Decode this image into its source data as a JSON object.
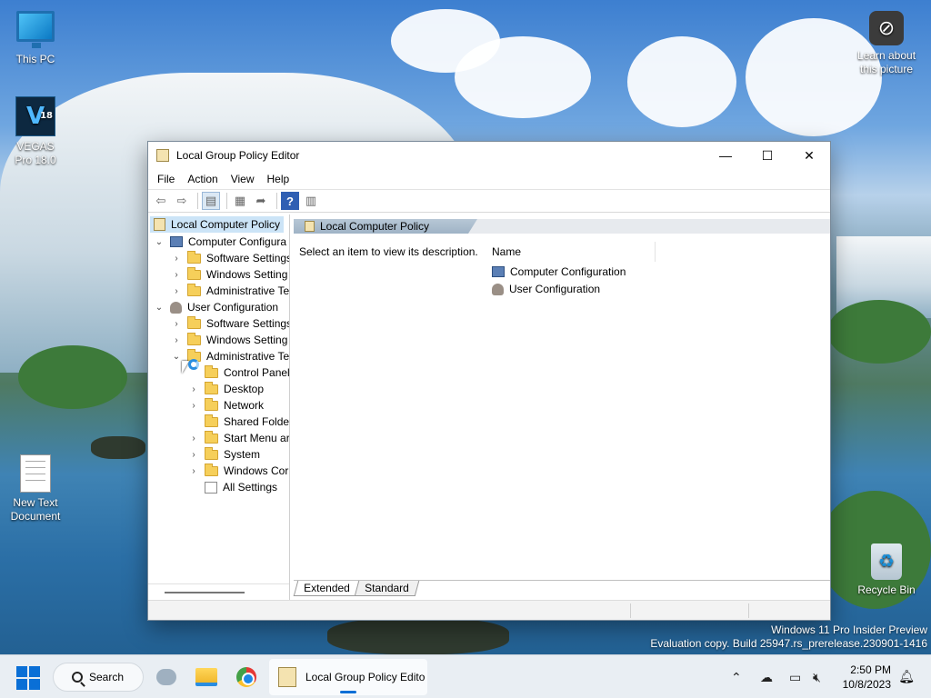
{
  "desktop": {
    "icons": [
      {
        "label": "This PC"
      },
      {
        "label": "VEGAS Pro 18.0",
        "glyph": "V",
        "badge": "18"
      },
      {
        "label": "New Text Document"
      },
      {
        "label": "Recycle Bin"
      },
      {
        "label": "Learn about this picture"
      }
    ],
    "watermark": {
      "line1": "Windows 11 Pro Insider Preview",
      "line2": "Evaluation copy. Build 25947.rs_prerelease.230901-1416"
    }
  },
  "window": {
    "title": "Local Group Policy Editor",
    "controls": {
      "minimize": "—",
      "maximize": "☐",
      "close": "✕"
    },
    "menu": [
      "File",
      "Action",
      "View",
      "Help"
    ],
    "toolbar_icons": [
      "back-arrow-icon",
      "forward-arrow-icon",
      "show-hide-tree-icon",
      "properties-icon",
      "export-list-icon",
      "help-icon",
      "filter-icon"
    ],
    "tree": {
      "root": "Local Computer Policy",
      "items": [
        {
          "label": "Computer Configura",
          "expanded": true,
          "level": 1,
          "icon": "computer"
        },
        {
          "label": "Software Settings",
          "level": 2,
          "icon": "folder"
        },
        {
          "label": "Windows Setting",
          "level": 2,
          "icon": "folder"
        },
        {
          "label": "Administrative Te",
          "level": 2,
          "icon": "folder"
        },
        {
          "label": "User Configuration",
          "expanded": true,
          "level": 1,
          "icon": "user"
        },
        {
          "label": "Software Settings",
          "level": 2,
          "icon": "folder"
        },
        {
          "label": "Windows Setting",
          "level": 2,
          "icon": "folder"
        },
        {
          "label": "Administrative Te",
          "expanded": true,
          "level": 2,
          "icon": "folder"
        },
        {
          "label": "Control Panel",
          "level": 3,
          "icon": "folder"
        },
        {
          "label": "Desktop",
          "level": 3,
          "icon": "folder"
        },
        {
          "label": "Network",
          "level": 3,
          "icon": "folder"
        },
        {
          "label": "Shared Folder",
          "level": 3,
          "icon": "folder"
        },
        {
          "label": "Start Menu ar",
          "level": 3,
          "icon": "folder"
        },
        {
          "label": "System",
          "level": 3,
          "icon": "folder"
        },
        {
          "label": "Windows Cor",
          "level": 3,
          "icon": "folder"
        },
        {
          "label": "All Settings",
          "level": 3,
          "icon": "settings"
        }
      ]
    },
    "right_pane": {
      "header": "Local Computer Policy",
      "description": "Select an item to view its description.",
      "column_name": "Name",
      "items": [
        "Computer Configuration",
        "User Configuration"
      ]
    },
    "tabs": [
      "Extended",
      "Standard"
    ]
  },
  "taskbar": {
    "search_label": "Search",
    "active_app_label": "Local Group Policy Edito",
    "time": "2:50 PM",
    "date": "10/8/2023",
    "accent": "#0a6fd6"
  }
}
